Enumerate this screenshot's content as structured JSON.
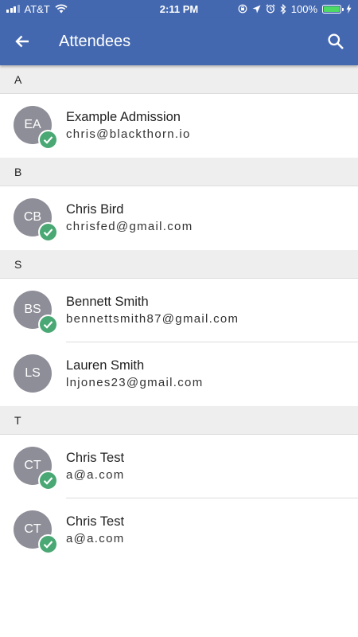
{
  "status_bar": {
    "carrier": "AT&T",
    "time": "2:11 PM",
    "battery": "100%",
    "battery_level": 1.0,
    "icons": [
      "signal-icon",
      "wifi-icon",
      "rotation-lock-icon",
      "location-icon",
      "alarm-icon",
      "bluetooth-icon",
      "battery-icon",
      "charging-icon"
    ]
  },
  "app_bar": {
    "title": "Attendees",
    "back_icon": "arrow-back-icon",
    "search_icon": "search-icon"
  },
  "colors": {
    "primary": "#4468b0",
    "avatar": "#8e8e98",
    "check": "#4aa874",
    "section_bg": "#eeeeee"
  },
  "sections": [
    {
      "letter": "A",
      "attendees": [
        {
          "initials": "EA",
          "name": "Example Admission",
          "email": "chris@blackthorn.io",
          "checked_in": true
        }
      ]
    },
    {
      "letter": "B",
      "attendees": [
        {
          "initials": "CB",
          "name": "Chris Bird",
          "email": "chrisfed@gmail.com",
          "checked_in": true
        }
      ]
    },
    {
      "letter": "S",
      "attendees": [
        {
          "initials": "BS",
          "name": "Bennett Smith",
          "email": "bennettsmith87@gmail.com",
          "checked_in": true
        },
        {
          "initials": "LS",
          "name": "Lauren Smith",
          "email": "lnjones23@gmail.com",
          "checked_in": false
        }
      ]
    },
    {
      "letter": "T",
      "attendees": [
        {
          "initials": "CT",
          "name": "Chris Test",
          "email": "a@a.com",
          "checked_in": true
        },
        {
          "initials": "CT",
          "name": "Chris Test",
          "email": "a@a.com",
          "checked_in": true
        }
      ]
    }
  ]
}
